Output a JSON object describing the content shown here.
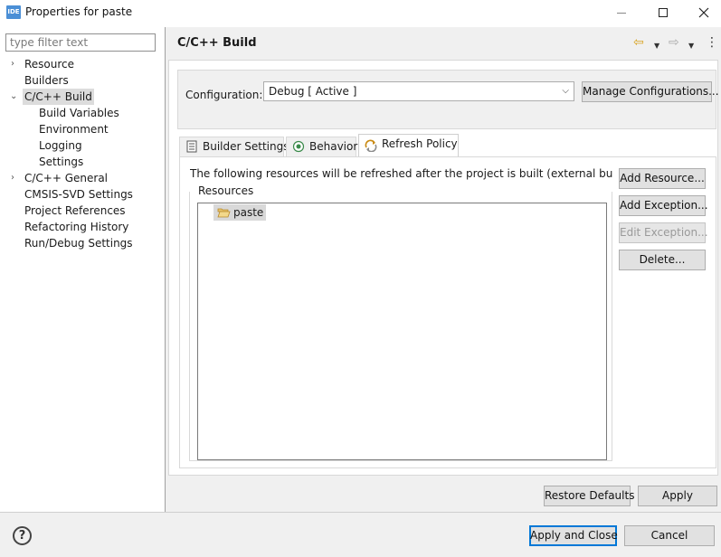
{
  "window": {
    "app_badge": "IDE",
    "title": "Properties for paste"
  },
  "sidebar": {
    "filter_placeholder": "type filter text",
    "items": [
      {
        "label": "Resource",
        "twisty": "›"
      },
      {
        "label": "Builders",
        "twisty": ""
      },
      {
        "label": "C/C++ Build",
        "twisty": "⌄",
        "selected": true
      },
      {
        "label": "Build Variables",
        "twisty": ""
      },
      {
        "label": "Environment",
        "twisty": ""
      },
      {
        "label": "Logging",
        "twisty": ""
      },
      {
        "label": "Settings",
        "twisty": ""
      },
      {
        "label": "C/C++ General",
        "twisty": "›"
      },
      {
        "label": "CMSIS-SVD Settings",
        "twisty": ""
      },
      {
        "label": "Project References",
        "twisty": ""
      },
      {
        "label": "Refactoring History",
        "twisty": ""
      },
      {
        "label": "Run/Debug Settings",
        "twisty": ""
      }
    ]
  },
  "header": {
    "title": "C/C++ Build",
    "back_glyph": "⇦",
    "forward_glyph": "⇨",
    "dropdown_glyph": "▼",
    "more_glyph": "⋮"
  },
  "configuration": {
    "label": "Configuration:",
    "value": "Debug  [ Active ]",
    "chevron": "⌵",
    "manage_label": "Manage Configurations..."
  },
  "tabs": [
    {
      "label": "Builder Settings",
      "icon": "list-icon",
      "active": false
    },
    {
      "label": "Behavior",
      "icon": "radio-icon",
      "active": false
    },
    {
      "label": "Refresh Policy",
      "icon": "refresh-icon",
      "active": true
    }
  ],
  "refresh_policy": {
    "description": "The following resources will be refreshed after the project is built (external builder only)",
    "group_label": "Resources",
    "resources": [
      {
        "label": "paste",
        "icon": "folder-open-icon"
      }
    ],
    "add_resource_label": "Add Resource...",
    "add_exception_label": "Add Exception...",
    "edit_exception_label": "Edit Exception...",
    "delete_label": "Delete..."
  },
  "page_buttons": {
    "restore_defaults": "Restore Defaults",
    "apply": "Apply"
  },
  "footer": {
    "help_glyph": "?",
    "apply_close": "Apply and Close",
    "cancel": "Cancel"
  },
  "colors": {
    "accent": "#0078d7",
    "panel_bg": "#f0f0f0",
    "selection": "#dcdcdc"
  }
}
